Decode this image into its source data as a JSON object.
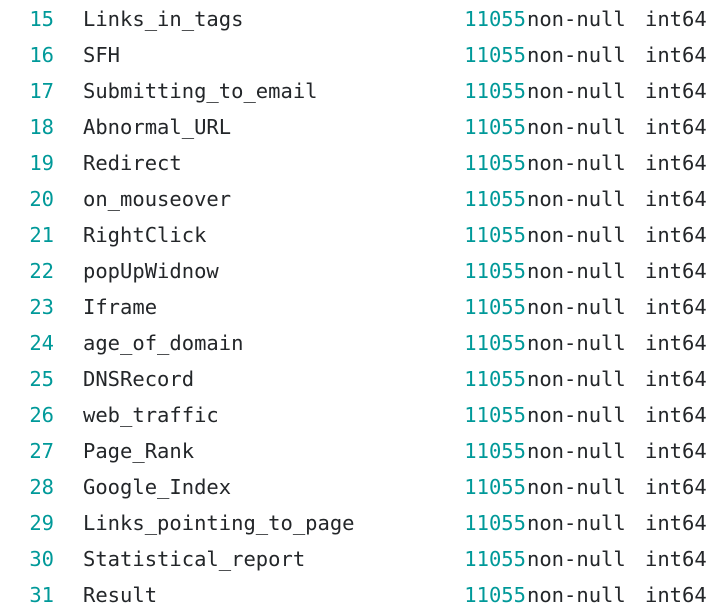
{
  "output": {
    "kind": "dataframe-info-table",
    "background_color": "#ffffff",
    "index_color": "#009999",
    "count_color": "#009999",
    "text_color": "#232629",
    "nonnull_label": "non-null",
    "dtype_label": "int64",
    "count_value": "11055",
    "rows": [
      {
        "index": "15",
        "name": "Links_in_tags",
        "count": "11055",
        "nonnull": "non-null",
        "dtype": "int64"
      },
      {
        "index": "16",
        "name": "SFH",
        "count": "11055",
        "nonnull": "non-null",
        "dtype": "int64"
      },
      {
        "index": "17",
        "name": "Submitting_to_email",
        "count": "11055",
        "nonnull": "non-null",
        "dtype": "int64"
      },
      {
        "index": "18",
        "name": "Abnormal_URL",
        "count": "11055",
        "nonnull": "non-null",
        "dtype": "int64"
      },
      {
        "index": "19",
        "name": "Redirect",
        "count": "11055",
        "nonnull": "non-null",
        "dtype": "int64"
      },
      {
        "index": "20",
        "name": "on_mouseover",
        "count": "11055",
        "nonnull": "non-null",
        "dtype": "int64"
      },
      {
        "index": "21",
        "name": "RightClick",
        "count": "11055",
        "nonnull": "non-null",
        "dtype": "int64"
      },
      {
        "index": "22",
        "name": "popUpWidnow",
        "count": "11055",
        "nonnull": "non-null",
        "dtype": "int64"
      },
      {
        "index": "23",
        "name": "Iframe",
        "count": "11055",
        "nonnull": "non-null",
        "dtype": "int64"
      },
      {
        "index": "24",
        "name": "age_of_domain",
        "count": "11055",
        "nonnull": "non-null",
        "dtype": "int64"
      },
      {
        "index": "25",
        "name": "DNSRecord",
        "count": "11055",
        "nonnull": "non-null",
        "dtype": "int64"
      },
      {
        "index": "26",
        "name": "web_traffic",
        "count": "11055",
        "nonnull": "non-null",
        "dtype": "int64"
      },
      {
        "index": "27",
        "name": "Page_Rank",
        "count": "11055",
        "nonnull": "non-null",
        "dtype": "int64"
      },
      {
        "index": "28",
        "name": "Google_Index",
        "count": "11055",
        "nonnull": "non-null",
        "dtype": "int64"
      },
      {
        "index": "29",
        "name": "Links_pointing_to_page",
        "count": "11055",
        "nonnull": "non-null",
        "dtype": "int64"
      },
      {
        "index": "30",
        "name": "Statistical_report",
        "count": "11055",
        "nonnull": "non-null",
        "dtype": "int64"
      },
      {
        "index": "31",
        "name": "Result",
        "count": "11055",
        "nonnull": "non-null",
        "dtype": "int64"
      }
    ]
  }
}
